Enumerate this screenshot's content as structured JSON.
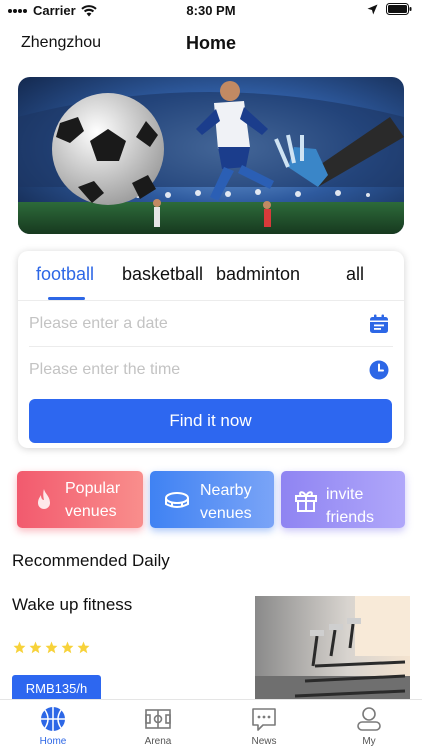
{
  "status_bar": {
    "carrier": "Carrier",
    "time": "8:30 PM"
  },
  "nav": {
    "city": "Zhengzhou",
    "title": "Home"
  },
  "banner": {
    "subject": "football-player-kicking-ball-stadium-image"
  },
  "sport_tabs": [
    {
      "label": "football",
      "active": true
    },
    {
      "label": "basketball",
      "active": false
    },
    {
      "label": "badminton",
      "active": false
    },
    {
      "label": "all",
      "active": false
    }
  ],
  "search": {
    "date_placeholder": "Please enter a date",
    "date_value": "",
    "time_placeholder": "Please enter the time",
    "time_value": "",
    "button_label": "Find it now"
  },
  "quick_actions": [
    {
      "line1": "Popular",
      "line2": "venues",
      "icon": "flame-icon"
    },
    {
      "line1": "Nearby",
      "line2": "venues",
      "icon": "stadium-icon"
    },
    {
      "line1": "invite",
      "line2": "friends",
      "icon": "gift-icon"
    }
  ],
  "recommended": {
    "section_title": "Recommended Daily",
    "items": [
      {
        "name": "Wake up fitness",
        "rating": 5,
        "price": "RMB135/h"
      }
    ]
  },
  "tab_bar": [
    {
      "label": "Home",
      "icon": "basketball-icon",
      "active": true
    },
    {
      "label": "Arena",
      "icon": "field-icon",
      "active": false
    },
    {
      "label": "News",
      "icon": "chat-icon",
      "active": false
    },
    {
      "label": "My",
      "icon": "user-icon",
      "active": false
    }
  ],
  "colors": {
    "accent": "#2d67f0",
    "star": "#f7d23a",
    "popular": "#f25a6e",
    "nearby": "#3f82f3",
    "invite": "#8f84f2"
  }
}
